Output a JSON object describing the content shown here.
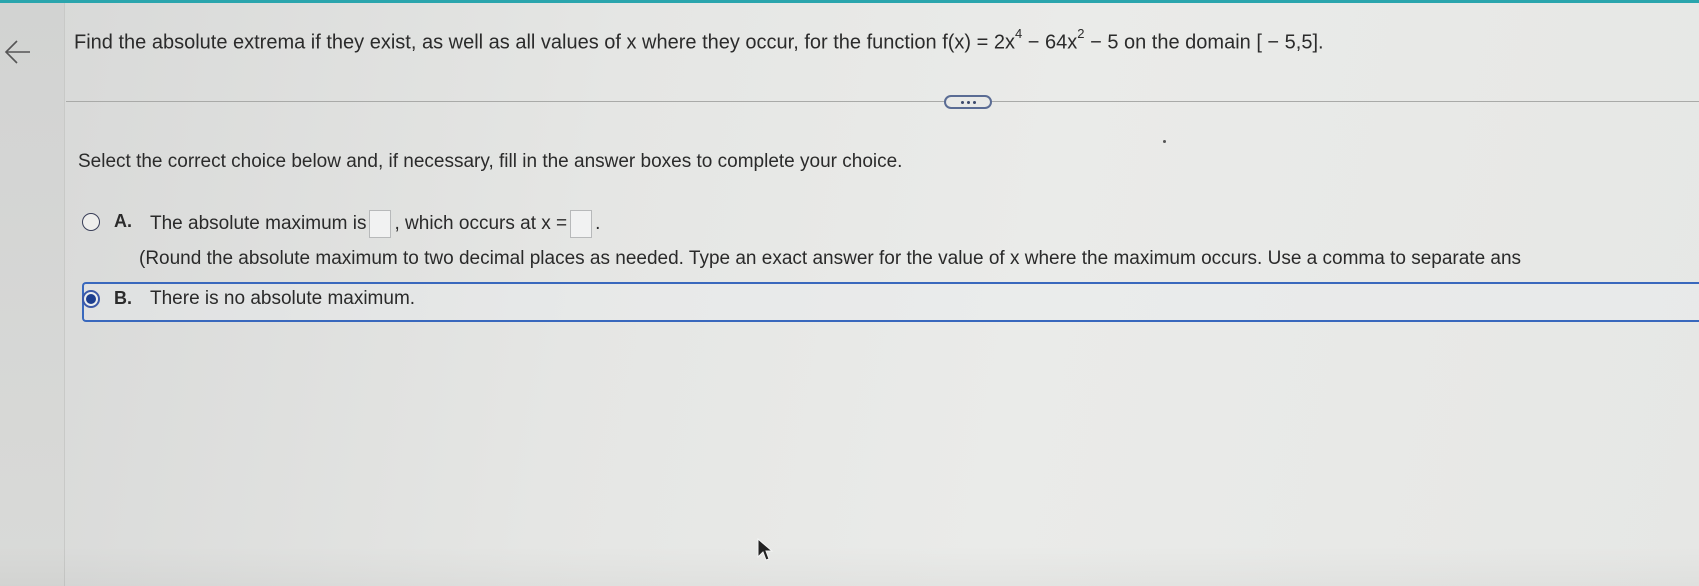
{
  "nav": {
    "back_icon": "back-arrow-icon"
  },
  "question": {
    "text_before": "Find the absolute extrema if they exist, as well as all values of x where they occur, for the function f(x) = 2x",
    "exp1": "4",
    "text_mid": " − 64x",
    "exp2": "2",
    "text_after": " − 5 on the domain [ − 5,5]."
  },
  "expand_button": {
    "icon": "ellipsis-icon"
  },
  "instruction": "Select the correct choice below and, if necessary, fill in the answer boxes to complete your choice.",
  "choices": {
    "a": {
      "letter": "A.",
      "text_part1": "The absolute maximum is",
      "text_part2": ", which occurs at x =",
      "text_part3": ".",
      "answer_box_1": "",
      "answer_box_2": "",
      "note": "(Round the absolute maximum to two decimal places as needed. Type an exact answer for the value of x where the maximum occurs. Use a comma to separate ans",
      "selected": false
    },
    "b": {
      "letter": "B.",
      "text": "There is no absolute maximum.",
      "selected": true
    }
  },
  "colors": {
    "accent": "#2aa5ad",
    "selection": "#3968bd",
    "radio_fill": "#1d3e8f"
  }
}
